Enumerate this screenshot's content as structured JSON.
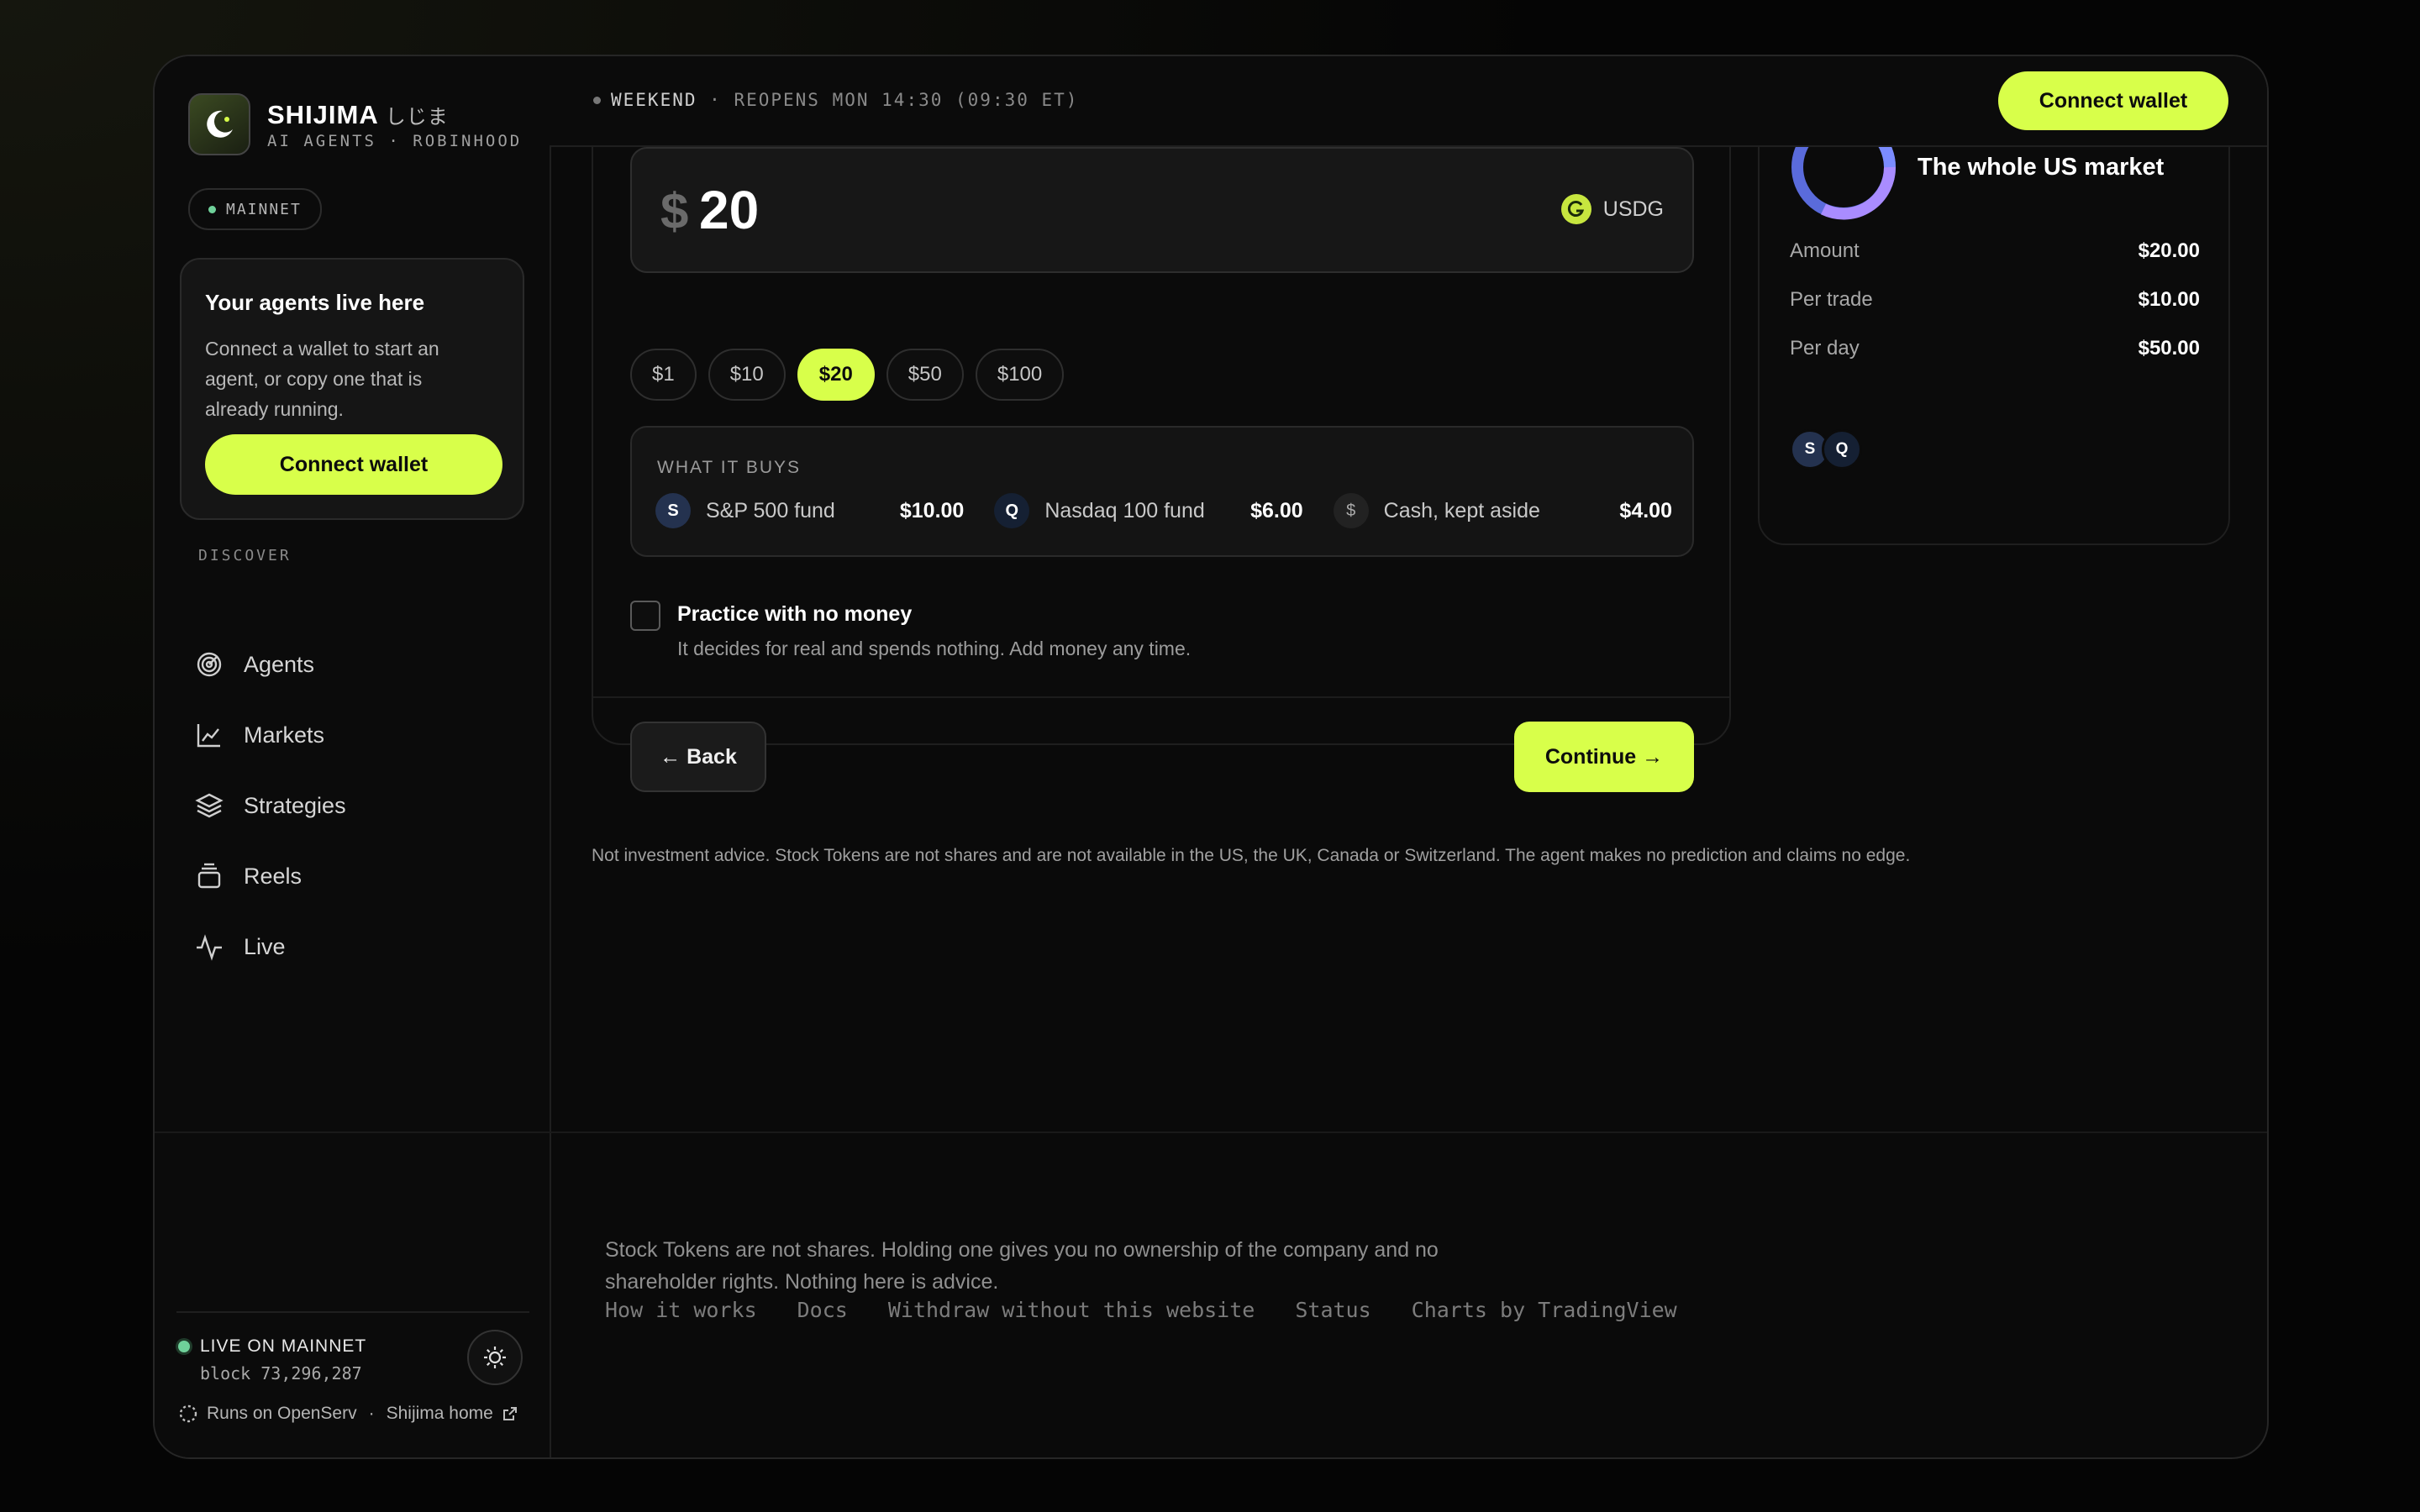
{
  "brand": {
    "name": "SHIJIMA",
    "name_jp": "しじま",
    "subtitle": "AI AGENTS · ROBINHOOD"
  },
  "network": {
    "label": "MAINNET",
    "dot_color": "#6fd19a"
  },
  "sidebar_card": {
    "title": "Your agents live here",
    "body": "Connect a wallet to start an agent, or copy one that is already running.",
    "button": "Connect wallet"
  },
  "discover": {
    "label": "DISCOVER",
    "items": [
      {
        "label": "Agents",
        "icon": "radar-icon"
      },
      {
        "label": "Markets",
        "icon": "chart-line-icon"
      },
      {
        "label": "Strategies",
        "icon": "layers-icon"
      },
      {
        "label": "Reels",
        "icon": "stack-icon"
      },
      {
        "label": "Live",
        "icon": "activity-icon"
      }
    ]
  },
  "sidebar_footer": {
    "live_label": "LIVE ON MAINNET",
    "block": "block 73,296,287",
    "runs_on": "Runs on OpenServ",
    "separator": "·",
    "home_link": "Shijima home"
  },
  "topbar": {
    "status_strong": "WEEKEND",
    "status_rest": " · REOPENS MON 14:30 (09:30 ET)",
    "connect_button": "Connect wallet"
  },
  "amount": {
    "currency_symbol": "$",
    "value": "20",
    "token": "USDG"
  },
  "presets": {
    "items": [
      "$1",
      "$10",
      "$20",
      "$50",
      "$100"
    ],
    "selected": "$20"
  },
  "what_it_buys": {
    "label": "WHAT IT BUYS",
    "funds": [
      {
        "icon_letter": "S",
        "name": "S&P 500 fund",
        "value": "$10.00",
        "color": "#24324f"
      },
      {
        "icon_letter": "Q",
        "name": "Nasdaq 100 fund",
        "value": "$6.00",
        "color": "#152033"
      },
      {
        "icon_letter": "$",
        "name": "Cash, kept aside",
        "value": "$4.00",
        "color": "#222222"
      }
    ]
  },
  "practice": {
    "title": "Practice with no money",
    "subtitle": "It decides for real and spends nothing. Add money any time.",
    "checked": false
  },
  "actions": {
    "back": "← Back",
    "continue": "Continue →"
  },
  "disclaimer": "Not investment advice. Stock Tokens are not shares and are not available in the US, the UK, Canada or Switzerland. The agent makes no prediction and claims no edge.",
  "summary": {
    "title": "The whole US market",
    "rows": [
      {
        "key": "Amount",
        "value": "$20.00"
      },
      {
        "key": "Per trade",
        "value": "$10.00"
      },
      {
        "key": "Per day",
        "value": "$50.00"
      }
    ],
    "avatars": [
      "S",
      "Q"
    ],
    "donut_colors": [
      "#7b8cff",
      "#a98cff",
      "#5a6bdb"
    ]
  },
  "footer": {
    "note": "Stock Tokens are not shares. Holding one gives you no ownership of the company and no shareholder rights. Nothing here is advice.",
    "links": [
      "How it works",
      "Docs",
      "Withdraw without this website",
      "Status",
      "Charts by TradingView"
    ]
  },
  "colors": {
    "accent": "#d8ff4a",
    "background": "#0a0a0a"
  }
}
